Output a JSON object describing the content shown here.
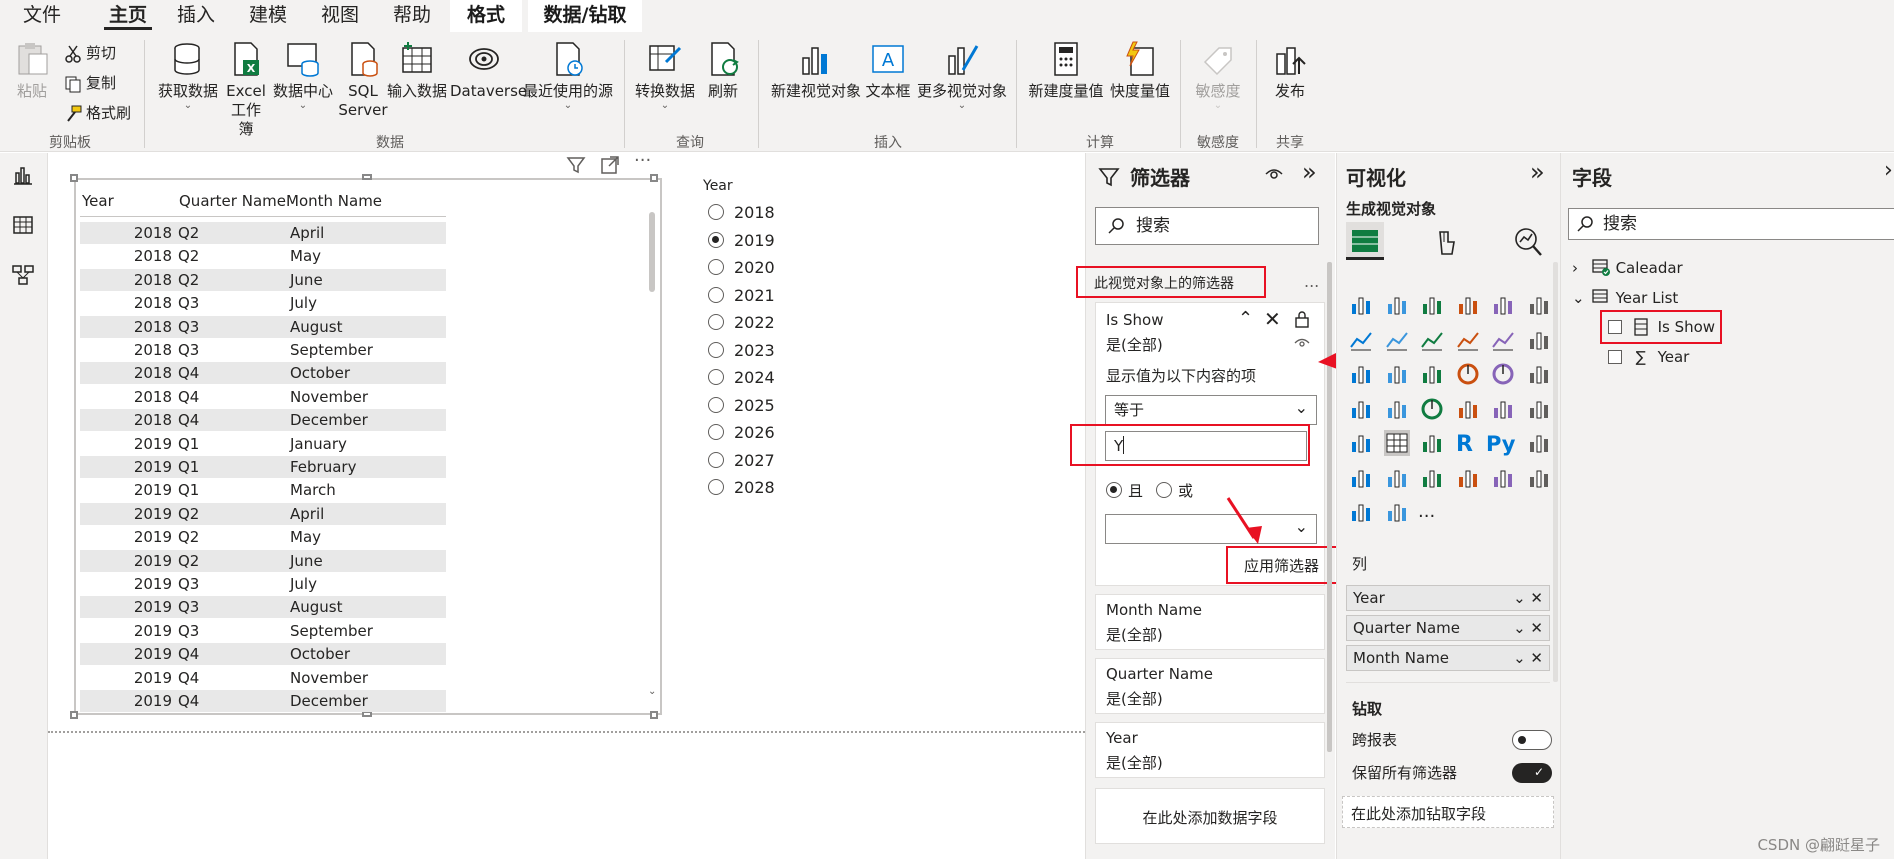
{
  "menu": {
    "items": [
      "文件",
      "主页",
      "插入",
      "建模",
      "视图",
      "帮助",
      "格式",
      "数据/钻取"
    ],
    "active_index": 1
  },
  "ribbon": {
    "clipboard": {
      "paste": "粘贴",
      "cut": "剪切",
      "copy": "复制",
      "format_painter": "格式刷",
      "group": "剪贴板"
    },
    "data": {
      "get_data": "获取数据",
      "excel_line1": "Excel",
      "excel_line2": "工作簿",
      "datahub": "数据中心",
      "sql_line1": "SQL",
      "sql_line2": "Server",
      "enter_data": "输入数据",
      "dataverse": "Dataverse",
      "recent": "最近使用的源",
      "group": "数据"
    },
    "query": {
      "transform": "转换数据",
      "refresh": "刷新",
      "group": "查询"
    },
    "insert": {
      "new_visual": "新建视觉对象",
      "textbox": "文本框",
      "more_visuals": "更多视觉对象",
      "group": "插入"
    },
    "calc": {
      "new_measure": "新建度量值",
      "quick_measure": "快度量值",
      "group": "计算"
    },
    "sensitivity": {
      "label": "敏感度",
      "group": "敏感度"
    },
    "share": {
      "publish": "发布",
      "group": "共享"
    }
  },
  "table": {
    "headers": [
      "Year",
      "Quarter Name",
      "Month Name"
    ],
    "rows": [
      [
        "2018",
        "Q2",
        "April"
      ],
      [
        "2018",
        "Q2",
        "May"
      ],
      [
        "2018",
        "Q2",
        "June"
      ],
      [
        "2018",
        "Q3",
        "July"
      ],
      [
        "2018",
        "Q3",
        "August"
      ],
      [
        "2018",
        "Q3",
        "September"
      ],
      [
        "2018",
        "Q4",
        "October"
      ],
      [
        "2018",
        "Q4",
        "November"
      ],
      [
        "2018",
        "Q4",
        "December"
      ],
      [
        "2019",
        "Q1",
        "January"
      ],
      [
        "2019",
        "Q1",
        "February"
      ],
      [
        "2019",
        "Q1",
        "March"
      ],
      [
        "2019",
        "Q2",
        "April"
      ],
      [
        "2019",
        "Q2",
        "May"
      ],
      [
        "2019",
        "Q2",
        "June"
      ],
      [
        "2019",
        "Q3",
        "July"
      ],
      [
        "2019",
        "Q3",
        "August"
      ],
      [
        "2019",
        "Q3",
        "September"
      ],
      [
        "2019",
        "Q4",
        "October"
      ],
      [
        "2019",
        "Q4",
        "November"
      ],
      [
        "2019",
        "Q4",
        "December"
      ]
    ]
  },
  "slicer": {
    "title": "Year",
    "options": [
      "2018",
      "2019",
      "2020",
      "2021",
      "2022",
      "2023",
      "2024",
      "2025",
      "2026",
      "2027",
      "2028"
    ],
    "selected": "2019"
  },
  "filters": {
    "title": "筛选器",
    "search_placeholder": "搜索",
    "section_label": "此视觉对象上的筛选器",
    "more": "...",
    "expanded_card": {
      "name": "Is Show",
      "value": "是(全部)",
      "condition_label": "显示值为以下内容的项",
      "operator": "等于",
      "input_value": "Y",
      "and_label": "且",
      "or_label": "或",
      "second_operator": "",
      "apply": "应用筛选器"
    },
    "cards": [
      {
        "name": "Month Name",
        "value": "是(全部)"
      },
      {
        "name": "Quarter Name",
        "value": "是(全部)"
      },
      {
        "name": "Year",
        "value": "是(全部)"
      }
    ],
    "add_field": "在此处添加数据字段"
  },
  "visualizations": {
    "title": "可视化",
    "build_label": "生成视觉对象",
    "columns_label": "列",
    "columns": [
      "Year",
      "Quarter Name",
      "Month Name"
    ],
    "drill_label": "钻取",
    "cross_report": "跨报表",
    "cross_report_on": false,
    "keep_filters": "保留所有筛选器",
    "keep_filters_on": true,
    "add_drill": "在此处添加钻取字段",
    "r_label": "R",
    "py_label": "Py",
    "more": "···"
  },
  "fields": {
    "title": "字段",
    "search_placeholder": "搜索",
    "tables": [
      {
        "name": "Caleadar",
        "expanded": false
      },
      {
        "name": "Year List",
        "expanded": true,
        "columns": [
          {
            "name": "Is Show",
            "kind": "column",
            "checked": false
          },
          {
            "name": "Year",
            "kind": "sum",
            "checked": false
          }
        ]
      }
    ]
  },
  "watermark": "CSDN @翩跹星子",
  "colors": {
    "accent_red": "#e81123",
    "excel_green": "#107c41",
    "pane_bg": "#f3f2f1"
  }
}
